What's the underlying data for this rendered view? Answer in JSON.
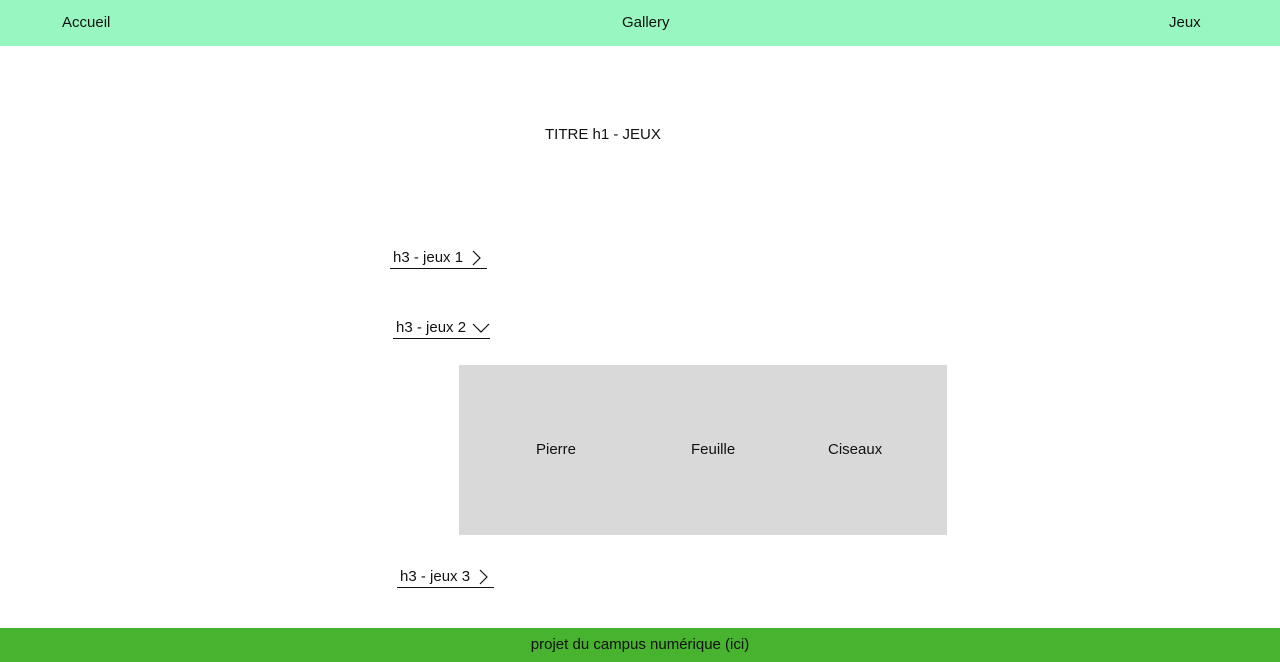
{
  "nav": {
    "accueil": "Accueil",
    "gallery": "Gallery",
    "jeux": "Jeux"
  },
  "main": {
    "title": "TITRE h1 - JEUX",
    "accordions": [
      {
        "label": "h3 - jeux 1",
        "state": "collapsed",
        "icon": "chevron-right-icon"
      },
      {
        "label": "h3 - jeux 2",
        "state": "expanded",
        "icon": "chevron-down-icon"
      },
      {
        "label": "h3 - jeux 3",
        "state": "collapsed",
        "icon": "chevron-right-icon"
      }
    ],
    "game": {
      "choices": [
        "Pierre",
        "Feuille",
        "Ciseaux"
      ]
    }
  },
  "footer": {
    "text": "projet du campus numérique (ici)"
  },
  "colors": {
    "topbar": "#98f7c0",
    "footer": "#47b32e",
    "panel": "#d9d9d9"
  }
}
